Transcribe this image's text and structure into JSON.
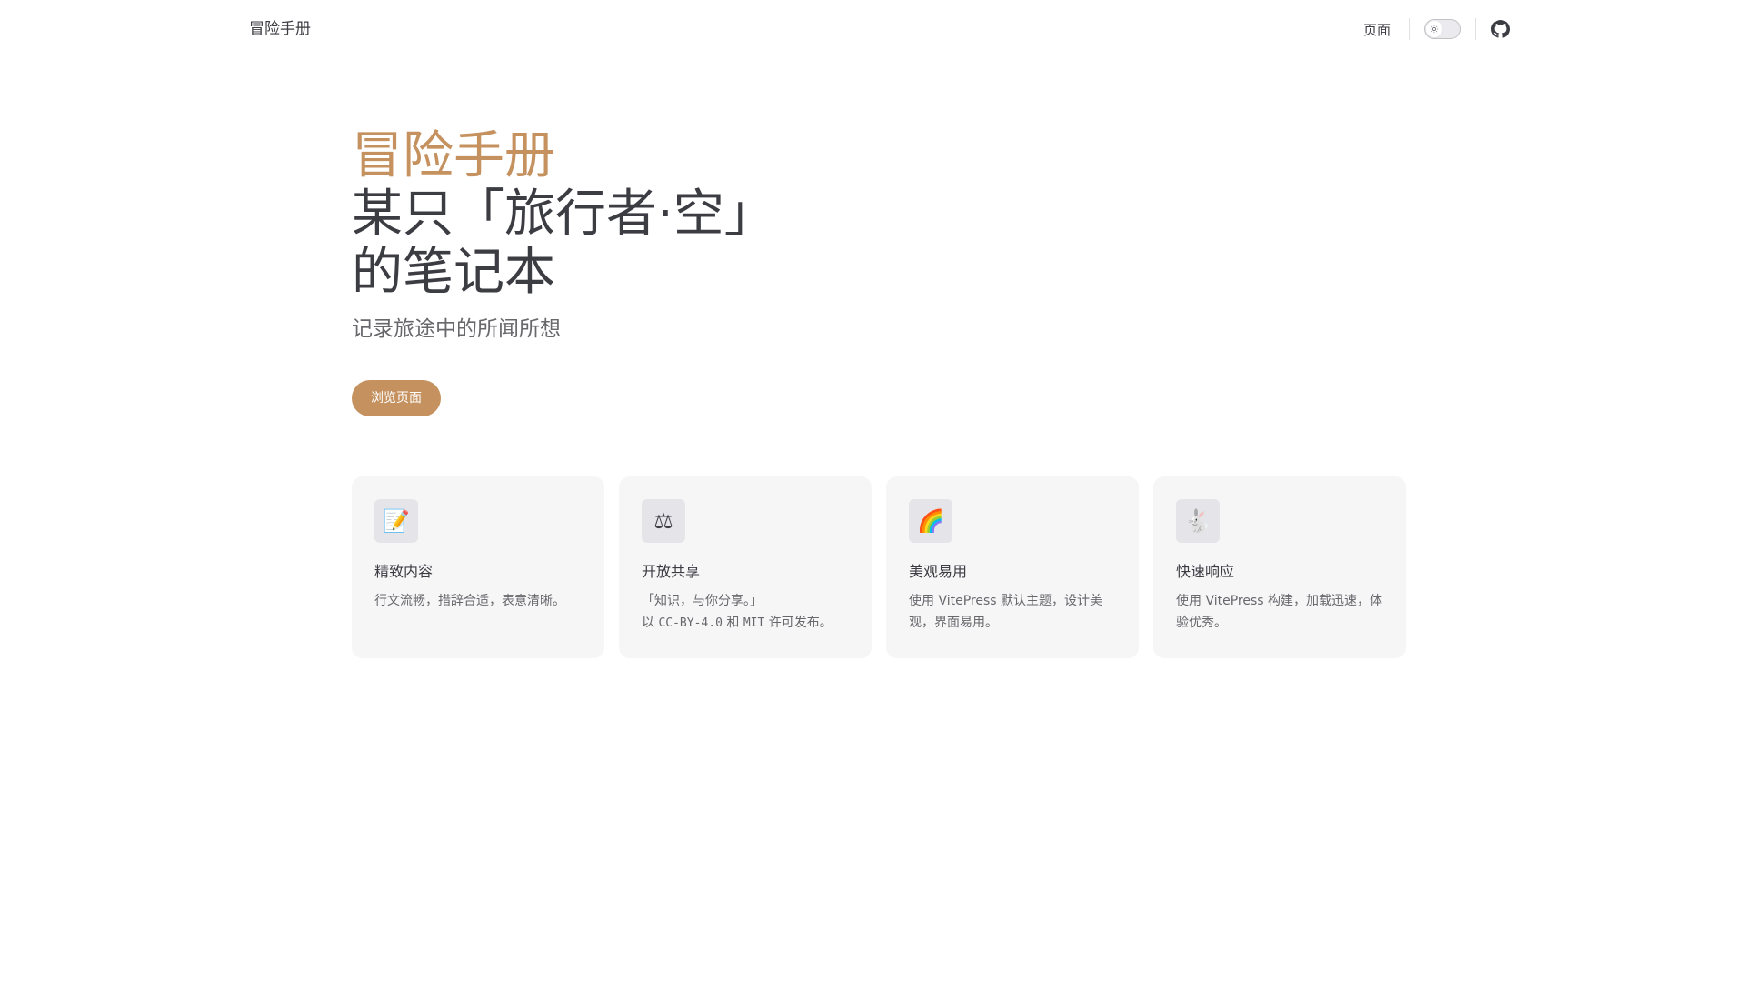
{
  "nav": {
    "brand": "冒险手册",
    "link_pages": "页面"
  },
  "hero": {
    "name": "冒险手册",
    "text": "某只「旅行者·空」的笔记本",
    "tagline": "记录旅途中的所闻所想",
    "action_label": "浏览页面"
  },
  "features": [
    {
      "icon": "📝",
      "title": "精致内容",
      "details_line1": "行文流畅，措辞合适，表意清晰。"
    },
    {
      "icon": "⚖",
      "title": "开放共享",
      "details_line1": "「知识，与你分享。」",
      "details_pre": "以 ",
      "details_code1": "CC-BY-4.0",
      "details_mid": " 和 ",
      "details_code2": "MIT",
      "details_post": " 许可发布。"
    },
    {
      "icon": "🌈",
      "title": "美观易用",
      "details_line1": "使用 VitePress 默认主题，设计美观，界面易用。"
    },
    {
      "icon": "🐇",
      "title": "快速响应",
      "details_line1": "使用 VitePress 构建，加载迅速，体验优秀。"
    }
  ],
  "colors": {
    "brand": "#c4915f",
    "text": "#3c3c43",
    "muted": "#67676c",
    "card_bg": "#f6f6f7"
  }
}
